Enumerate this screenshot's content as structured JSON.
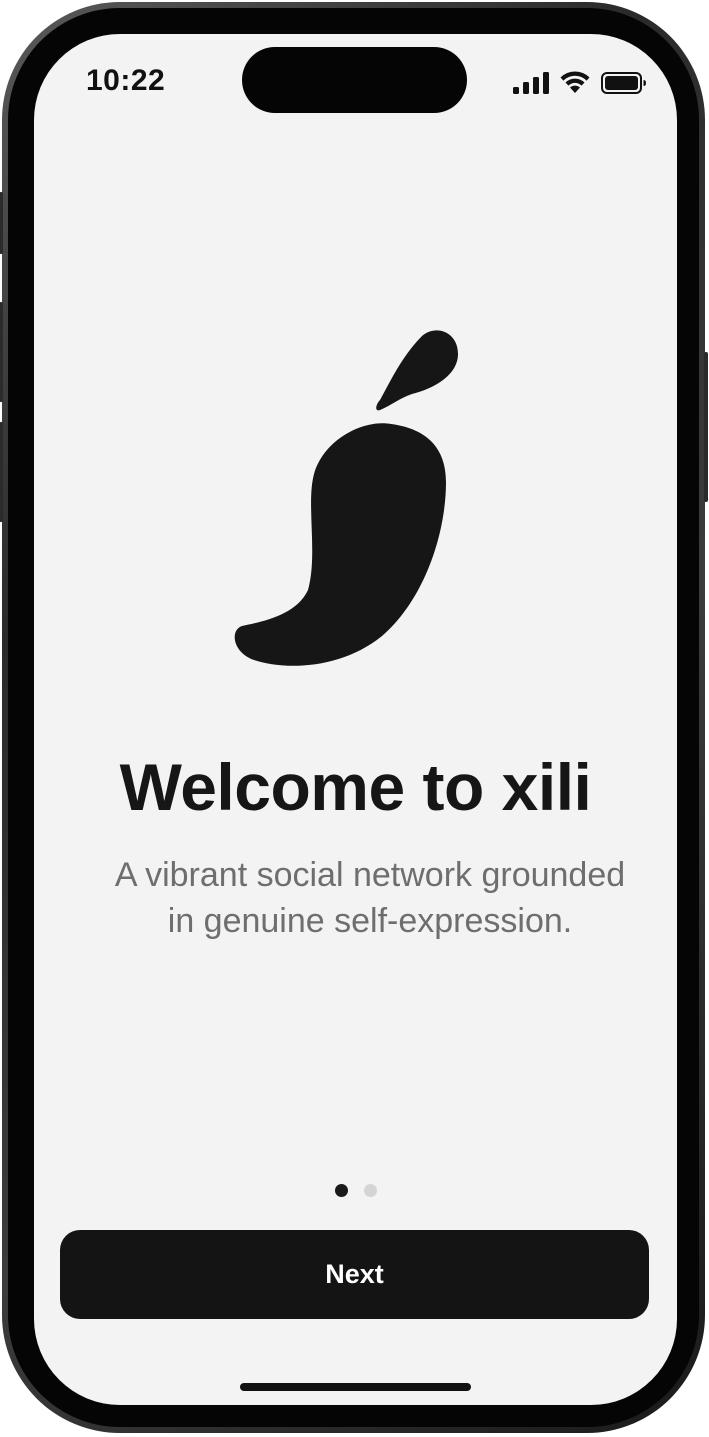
{
  "status_bar": {
    "time": "10:22",
    "icons": [
      "cellular-signal-icon",
      "wifi-icon",
      "battery-icon"
    ]
  },
  "onboarding": {
    "logo_icon": "chili-pepper-logo-icon",
    "title": "Welcome to xili",
    "subtitle_line1": "A vibrant social network grounded",
    "subtitle_line2": "in genuine self-expression.",
    "page_indicator": {
      "total": 2,
      "current": 1
    },
    "next_label": "Next"
  },
  "colors": {
    "screen_background": "#f3f3f3",
    "primary": "#141414",
    "subtitle": "#6e6e6e",
    "dot_inactive": "#d4d4d4"
  }
}
